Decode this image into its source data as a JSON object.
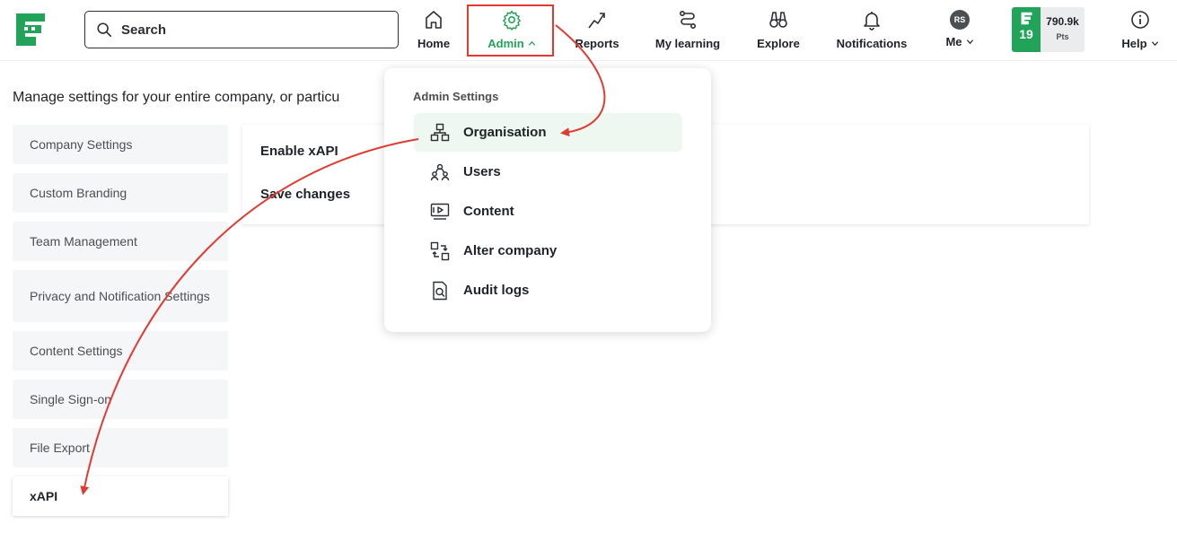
{
  "search": {
    "placeholder": "Search"
  },
  "nav": {
    "home": "Home",
    "admin": "Admin",
    "reports": "Reports",
    "my_learning": "My learning",
    "explore": "Explore",
    "notifications": "Notifications",
    "me": "Me",
    "me_initials": "RS",
    "help": "Help"
  },
  "points": {
    "level": "19",
    "value": "790.9k",
    "unit": "Pts"
  },
  "page": {
    "description": "Manage settings for your entire company, or particu"
  },
  "sidebar": {
    "items": [
      {
        "label": "Company Settings"
      },
      {
        "label": "Custom Branding"
      },
      {
        "label": "Team Management"
      },
      {
        "label": "Privacy and Notification Settings"
      },
      {
        "label": "Content Settings"
      },
      {
        "label": "Single Sign-on"
      },
      {
        "label": "File Export"
      },
      {
        "label": "xAPI"
      }
    ]
  },
  "panel": {
    "enable_label": "Enable xAPI",
    "save_label": "Save changes"
  },
  "admin_menu": {
    "title": "Admin Settings",
    "items": [
      {
        "label": "Organisation",
        "icon": "organisation-icon"
      },
      {
        "label": "Users",
        "icon": "users-icon"
      },
      {
        "label": "Content",
        "icon": "content-icon"
      },
      {
        "label": "Alter company",
        "icon": "alter-company-icon"
      },
      {
        "label": "Audit logs",
        "icon": "audit-logs-icon"
      }
    ]
  },
  "colors": {
    "brand": "#21a35a",
    "annotation": "#e23a31",
    "highlight": "#eef7f0"
  }
}
